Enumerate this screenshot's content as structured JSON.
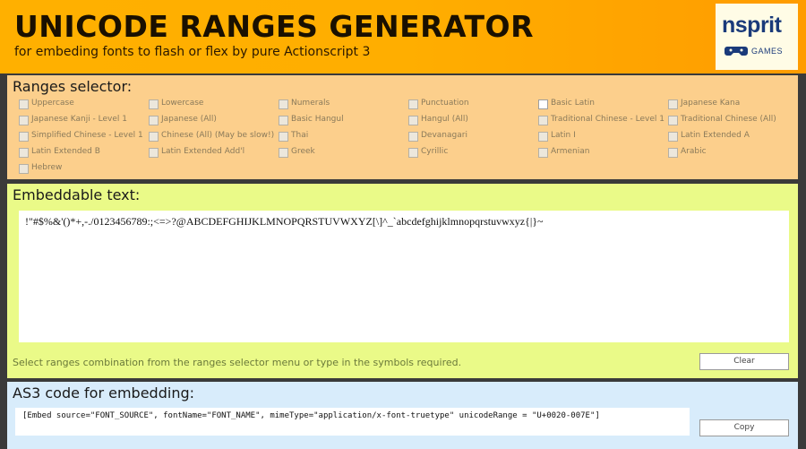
{
  "header": {
    "title": "UNICODE RANGES GENERATOR",
    "subtitle": "for embeding fonts to flash or flex by pure Actionscript 3",
    "logo_text": "nsprit",
    "logo_sub": "GAMES"
  },
  "ranges": {
    "title": "Ranges selector:",
    "items": [
      {
        "label": "Uppercase",
        "checked": false
      },
      {
        "label": "Lowercase",
        "checked": false
      },
      {
        "label": "Numerals",
        "checked": false
      },
      {
        "label": "Punctuation",
        "checked": false
      },
      {
        "label": "Basic Latin",
        "checked": true
      },
      {
        "label": "Japanese Kana",
        "checked": false
      },
      {
        "label": "Japanese Kanji - Level 1",
        "checked": false
      },
      {
        "label": "Japanese (All)",
        "checked": false
      },
      {
        "label": "Basic Hangul",
        "checked": false
      },
      {
        "label": "Hangul (All)",
        "checked": false
      },
      {
        "label": "Traditional Chinese - Level 1",
        "checked": false
      },
      {
        "label": "Traditional Chinese (All)",
        "checked": false
      },
      {
        "label": "Simplified Chinese - Level 1",
        "checked": false
      },
      {
        "label": "Chinese (All) (May be slow!)",
        "checked": false
      },
      {
        "label": "Thai",
        "checked": false
      },
      {
        "label": "Devanagari",
        "checked": false
      },
      {
        "label": "Latin I",
        "checked": false
      },
      {
        "label": "Latin Extended A",
        "checked": false
      },
      {
        "label": "Latin Extended B",
        "checked": false
      },
      {
        "label": "Latin Extended Add'l",
        "checked": false
      },
      {
        "label": "Greek",
        "checked": false
      },
      {
        "label": "Cyrillic",
        "checked": false
      },
      {
        "label": "Armenian",
        "checked": false
      },
      {
        "label": "Arabic",
        "checked": false
      },
      {
        "label": "Hebrew",
        "checked": false
      }
    ]
  },
  "embed": {
    "title": "Embeddable text:",
    "text": "!\"#$%&'()*+,-./0123456789:;<=>?@ABCDEFGHIJKLMNOPQRSTUVWXYZ[\\]^_`abcdefghijklmnopqrstuvwxyz{|}~",
    "hint": "Select ranges combination from the ranges selector menu or type in the symbols required.",
    "clear_label": "Clear"
  },
  "as3": {
    "title": "AS3 code for embedding:",
    "code": "[Embed source=\"FONT_SOURCE\", fontName=\"FONT_NAME\", mimeType=\"application/x-font-truetype\" unicodeRange = \"U+0020-007E\"]",
    "copy_label": "Copy"
  },
  "colors": {
    "header_bg": "#ffb000",
    "ranges_bg": "#fccf8c",
    "embed_bg": "#eafa88",
    "as3_bg": "#d8ecfb"
  }
}
